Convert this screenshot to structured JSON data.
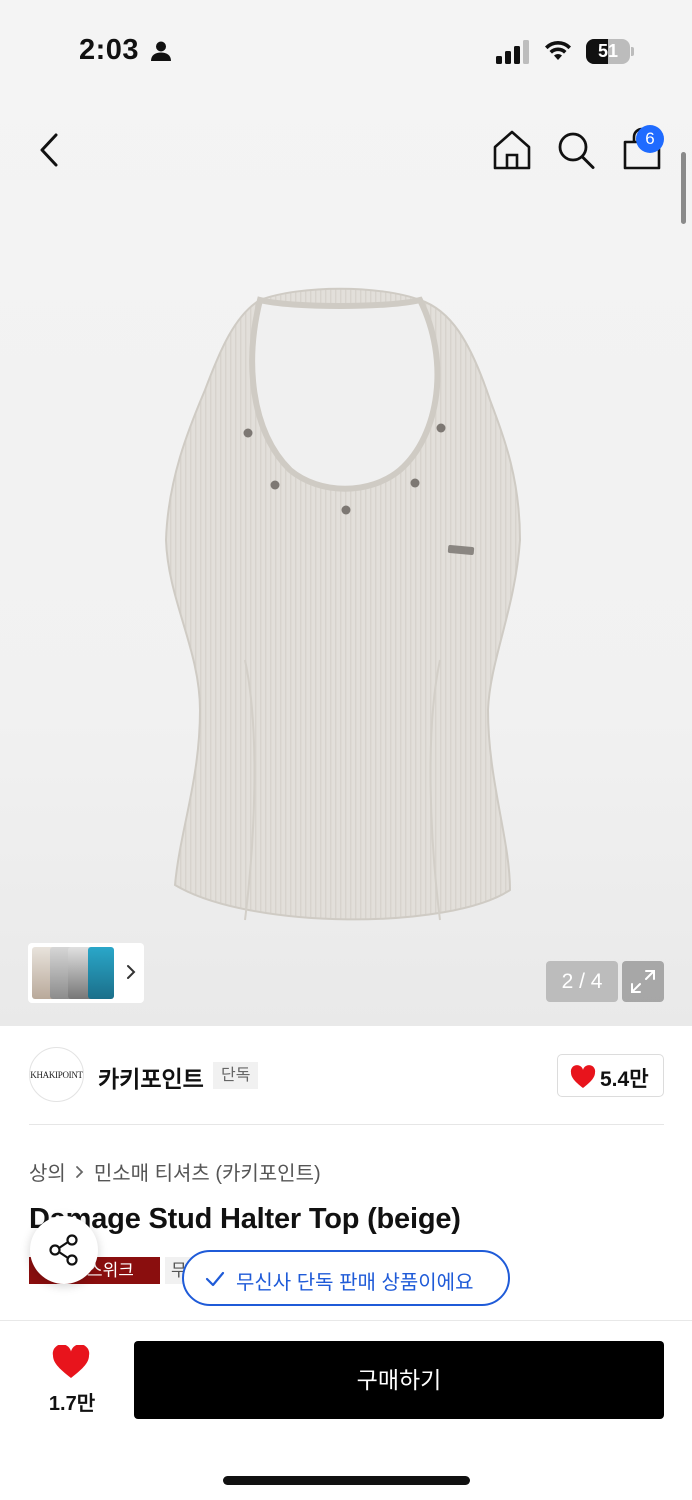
{
  "status_bar": {
    "time": "2:03",
    "battery_level": "51",
    "battery_fraction": 0.51
  },
  "header": {
    "cart_count": "6"
  },
  "gallery": {
    "pager": "2 / 4"
  },
  "brand": {
    "logo_text": "KHAKIPOINT",
    "name": "카키포인트",
    "tag": "단독",
    "likes": "5.4만"
  },
  "product": {
    "breadcrumb": [
      "상의",
      "민소매 티셔츠 (카키포인트)"
    ],
    "title": "Damage Stud Halter Top (beige)",
    "tag_red": "스위크",
    "tag_grey": "무",
    "exclusive_notice": "무신사 단독 판매 상품이에요"
  },
  "bottom_bar": {
    "wish_count": "1.7만",
    "buy_label": "구매하기"
  },
  "colors": {
    "accent_blue": "#1f6bff",
    "brand_red": "#8a0e0e",
    "heart_red": "#e8141c",
    "buy_black": "#000000"
  }
}
